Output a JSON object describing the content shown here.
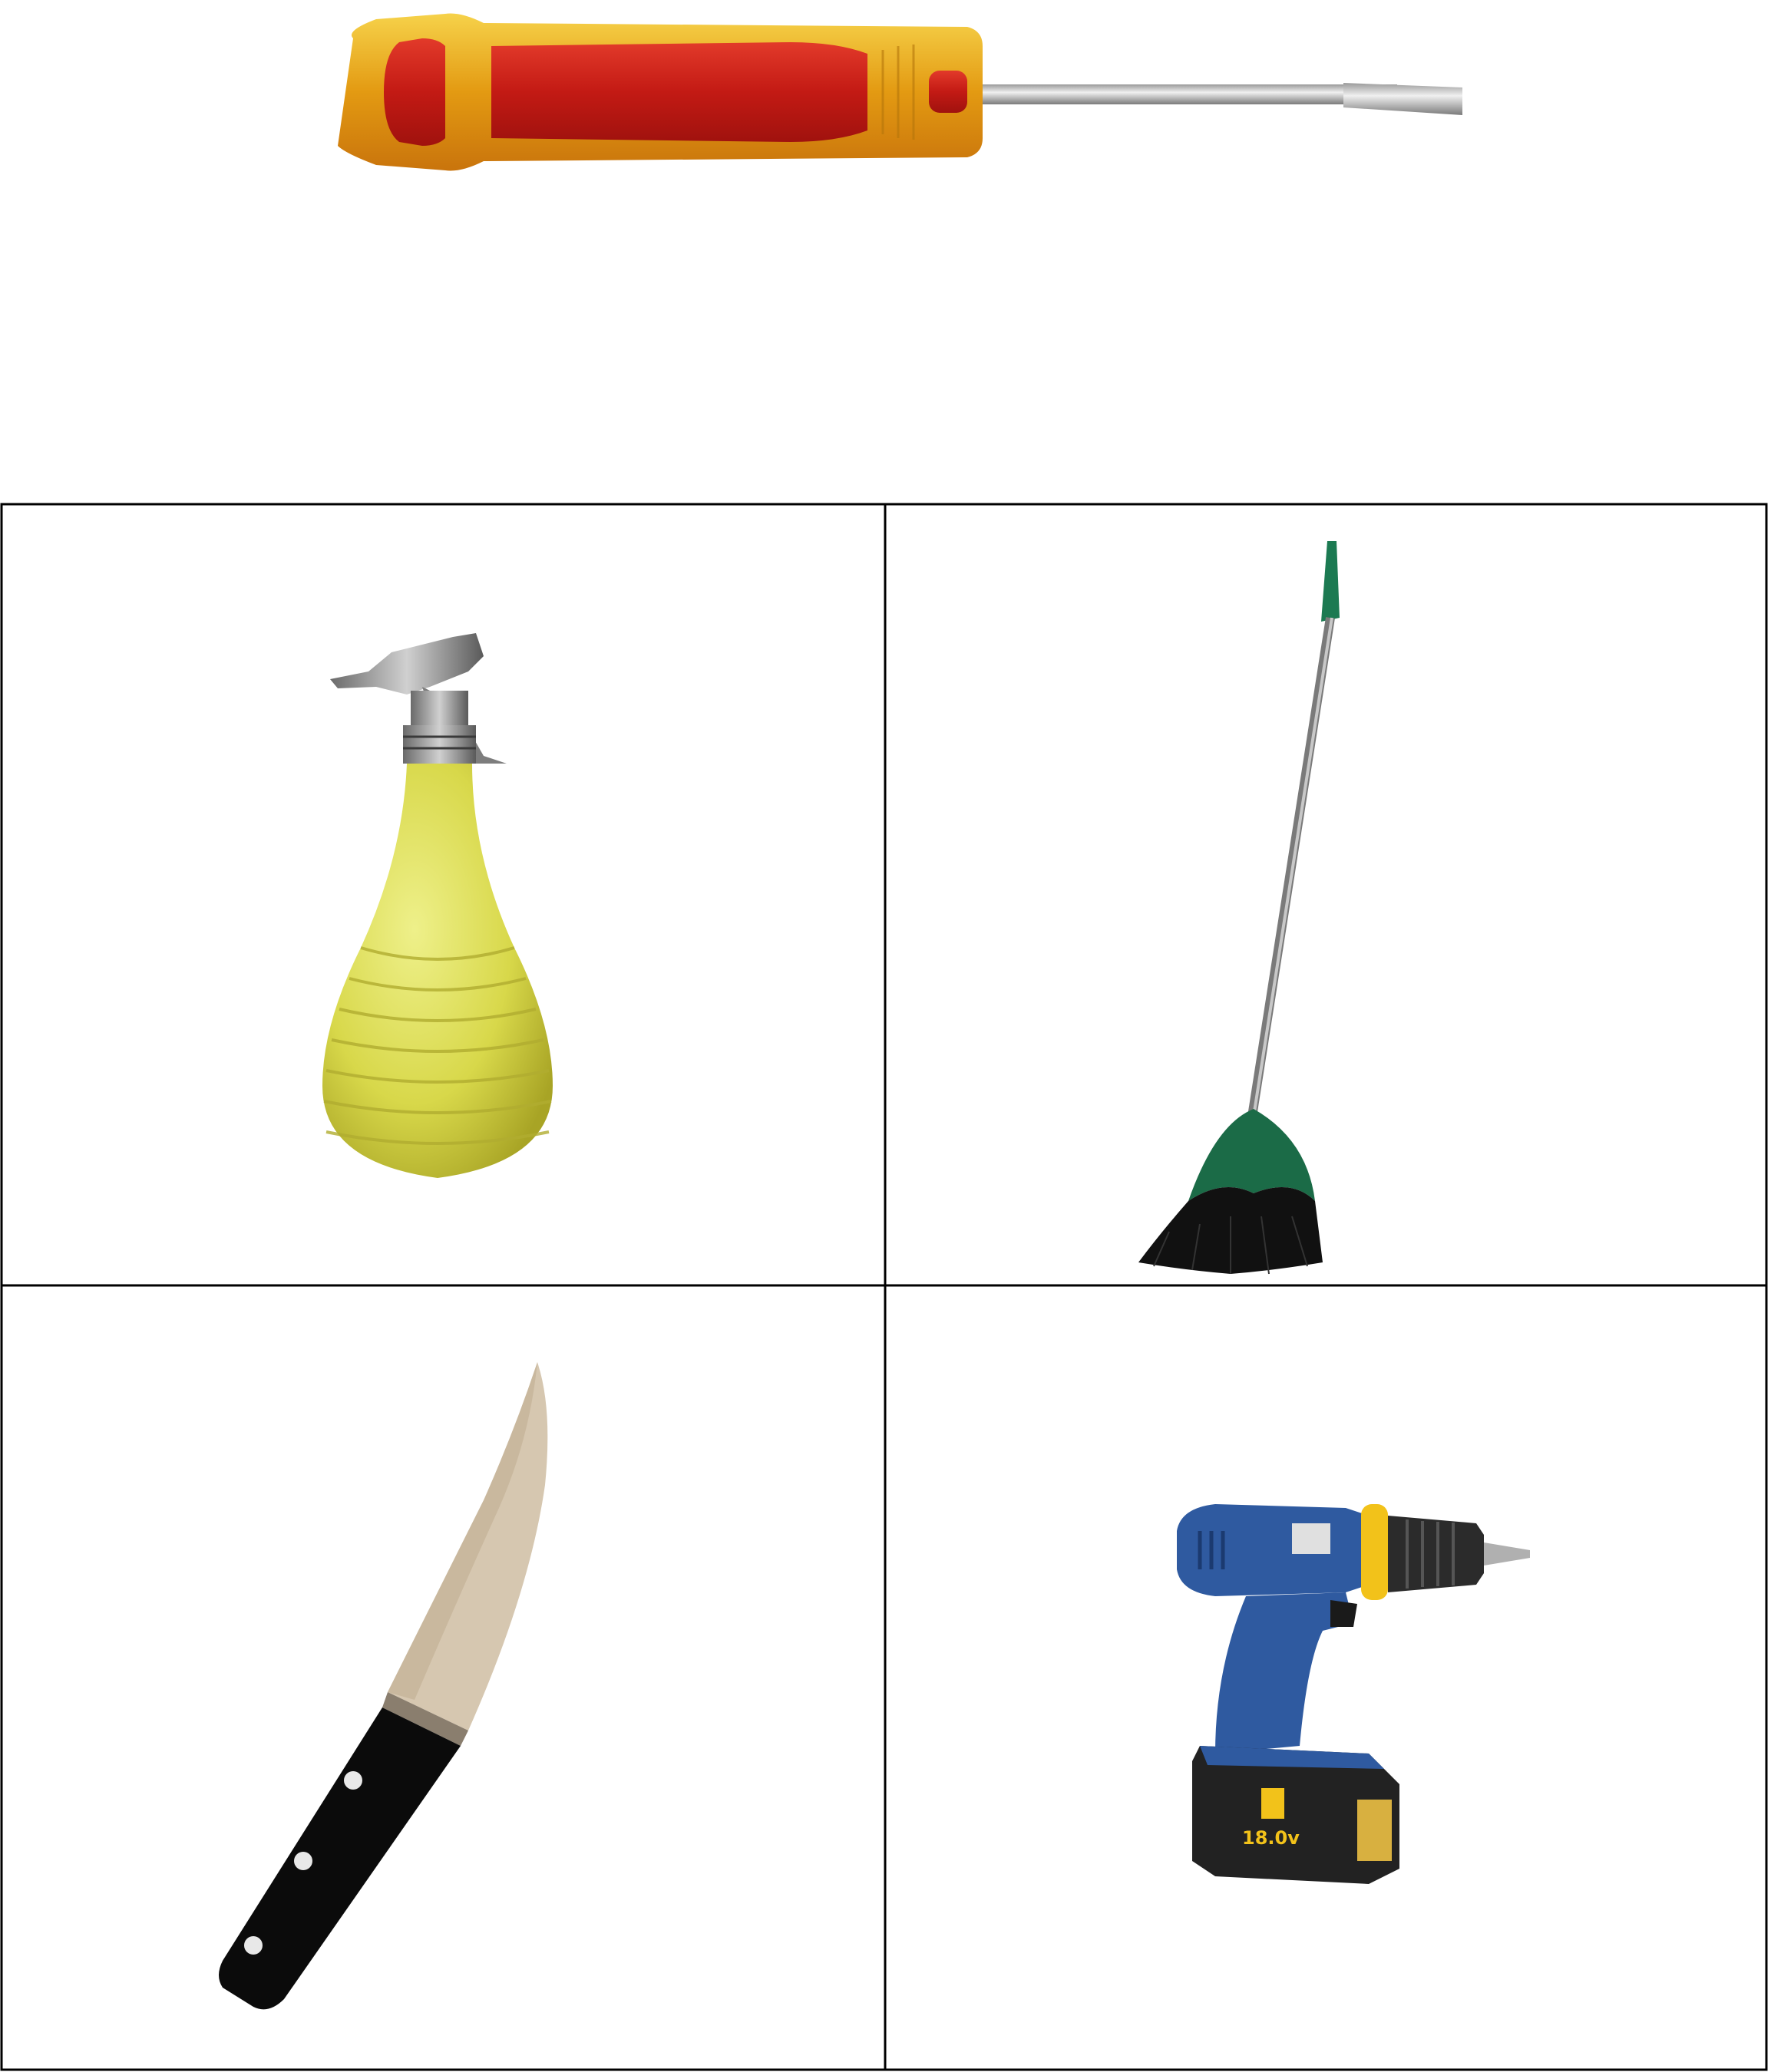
{
  "prompt_item": {
    "icon": "screwdriver-icon"
  },
  "options": [
    {
      "icon": "spray-bottle-icon"
    },
    {
      "icon": "broom-icon"
    },
    {
      "icon": "kitchen-knife-icon"
    },
    {
      "icon": "cordless-drill-icon",
      "battery_label": "18.0v"
    }
  ],
  "colors": {
    "grid_line": "#000000",
    "screwdriver_handle": "#e8b21a",
    "screwdriver_grip": "#d8281c",
    "spray_body": "#dede56",
    "broom_head": "#1b6b47",
    "knife_handle": "#0b0b0b",
    "knife_blade": "#d6c7b0",
    "drill_body": "#2f5aa0",
    "drill_accent": "#f2c21a"
  }
}
